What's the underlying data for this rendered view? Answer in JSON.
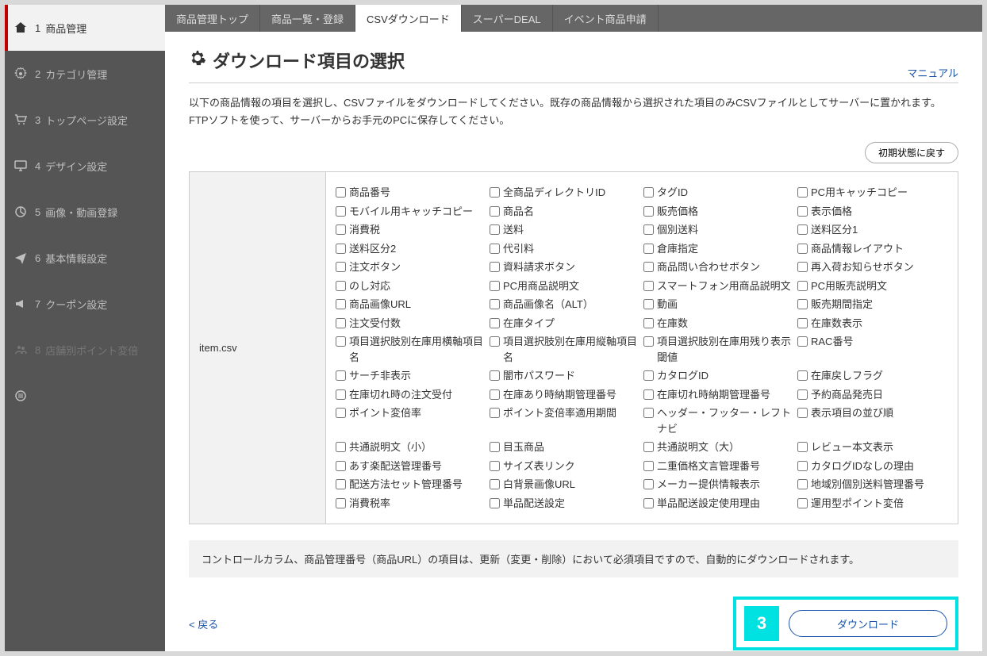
{
  "sidebar": {
    "items": [
      {
        "num": "1",
        "label": "商品管理",
        "icon": "home"
      },
      {
        "num": "2",
        "label": "カテゴリ管理",
        "icon": "gear"
      },
      {
        "num": "3",
        "label": "トップページ設定",
        "icon": "cart"
      },
      {
        "num": "4",
        "label": "デザイン設定",
        "icon": "monitor"
      },
      {
        "num": "5",
        "label": "画像・動画登録",
        "icon": "chart"
      },
      {
        "num": "6",
        "label": "基本情報設定",
        "icon": "send"
      },
      {
        "num": "7",
        "label": "クーポン設定",
        "icon": "megaphone"
      },
      {
        "num": "8",
        "label": "店舗別ポイント変倍",
        "icon": "users",
        "disabled": true
      },
      {
        "num": "",
        "label": "",
        "icon": "list"
      }
    ]
  },
  "tabs": [
    {
      "label": "商品管理トップ"
    },
    {
      "label": "商品一覧・登録"
    },
    {
      "label": "CSVダウンロード",
      "active": true
    },
    {
      "label": "スーパーDEAL"
    },
    {
      "label": "イベント商品申請"
    }
  ],
  "page": {
    "title": "ダウンロード項目の選択",
    "manual": "マニュアル",
    "desc": "以下の商品情報の項目を選択し、CSVファイルをダウンロードしてください。既存の商品情報から選択された項目のみCSVファイルとしてサーバーに置かれます。FTPソフトを使って、サーバーからお手元のPCに保存してください。",
    "reset": "初期状態に戻す",
    "filename": "item.csv",
    "note": "コントロールカラム、商品管理番号（商品URL）の項目は、更新（変更・削除）において必須項目ですので、自動的にダウンロードされます。",
    "back": "< 戻る",
    "download": "ダウンロード",
    "badge": "3"
  },
  "fields": [
    [
      "商品番号",
      "全商品ディレクトリID",
      "タグID",
      "PC用キャッチコピー"
    ],
    [
      "モバイル用キャッチコピー",
      "商品名",
      "販売価格",
      "表示価格"
    ],
    [
      "消費税",
      "送料",
      "個別送料",
      "送料区分1"
    ],
    [
      "送料区分2",
      "代引料",
      "倉庫指定",
      "商品情報レイアウト"
    ],
    [
      "注文ボタン",
      "資料請求ボタン",
      "商品問い合わせボタン",
      "再入荷お知らせボタン"
    ],
    [
      "のし対応",
      "PC用商品説明文",
      "スマートフォン用商品説明文",
      "PC用販売説明文"
    ],
    [
      "商品画像URL",
      "商品画像名（ALT）",
      "動画",
      "販売期間指定"
    ],
    [
      "注文受付数",
      "在庫タイプ",
      "在庫数",
      "在庫数表示"
    ],
    [
      "項目選択肢別在庫用横軸項目名",
      "項目選択肢別在庫用縦軸項目名",
      "項目選択肢別在庫用残り表示閾値",
      "RAC番号"
    ],
    [
      "サーチ非表示",
      "闇市パスワード",
      "カタログID",
      "在庫戻しフラグ"
    ],
    [
      "在庫切れ時の注文受付",
      "在庫あり時納期管理番号",
      "在庫切れ時納期管理番号",
      "予約商品発売日"
    ],
    [
      "ポイント変倍率",
      "ポイント変倍率適用期間",
      "ヘッダー・フッター・レフトナビ",
      "表示項目の並び順"
    ],
    [
      "共通説明文（小）",
      "目玉商品",
      "共通説明文（大）",
      "レビュー本文表示"
    ],
    [
      "あす楽配送管理番号",
      "サイズ表リンク",
      "二重価格文言管理番号",
      "カタログIDなしの理由"
    ],
    [
      "配送方法セット管理番号",
      "白背景画像URL",
      "メーカー提供情報表示",
      "地域別個別送料管理番号"
    ],
    [
      "消費税率",
      "単品配送設定",
      "単品配送設定使用理由",
      "運用型ポイント変倍"
    ]
  ]
}
